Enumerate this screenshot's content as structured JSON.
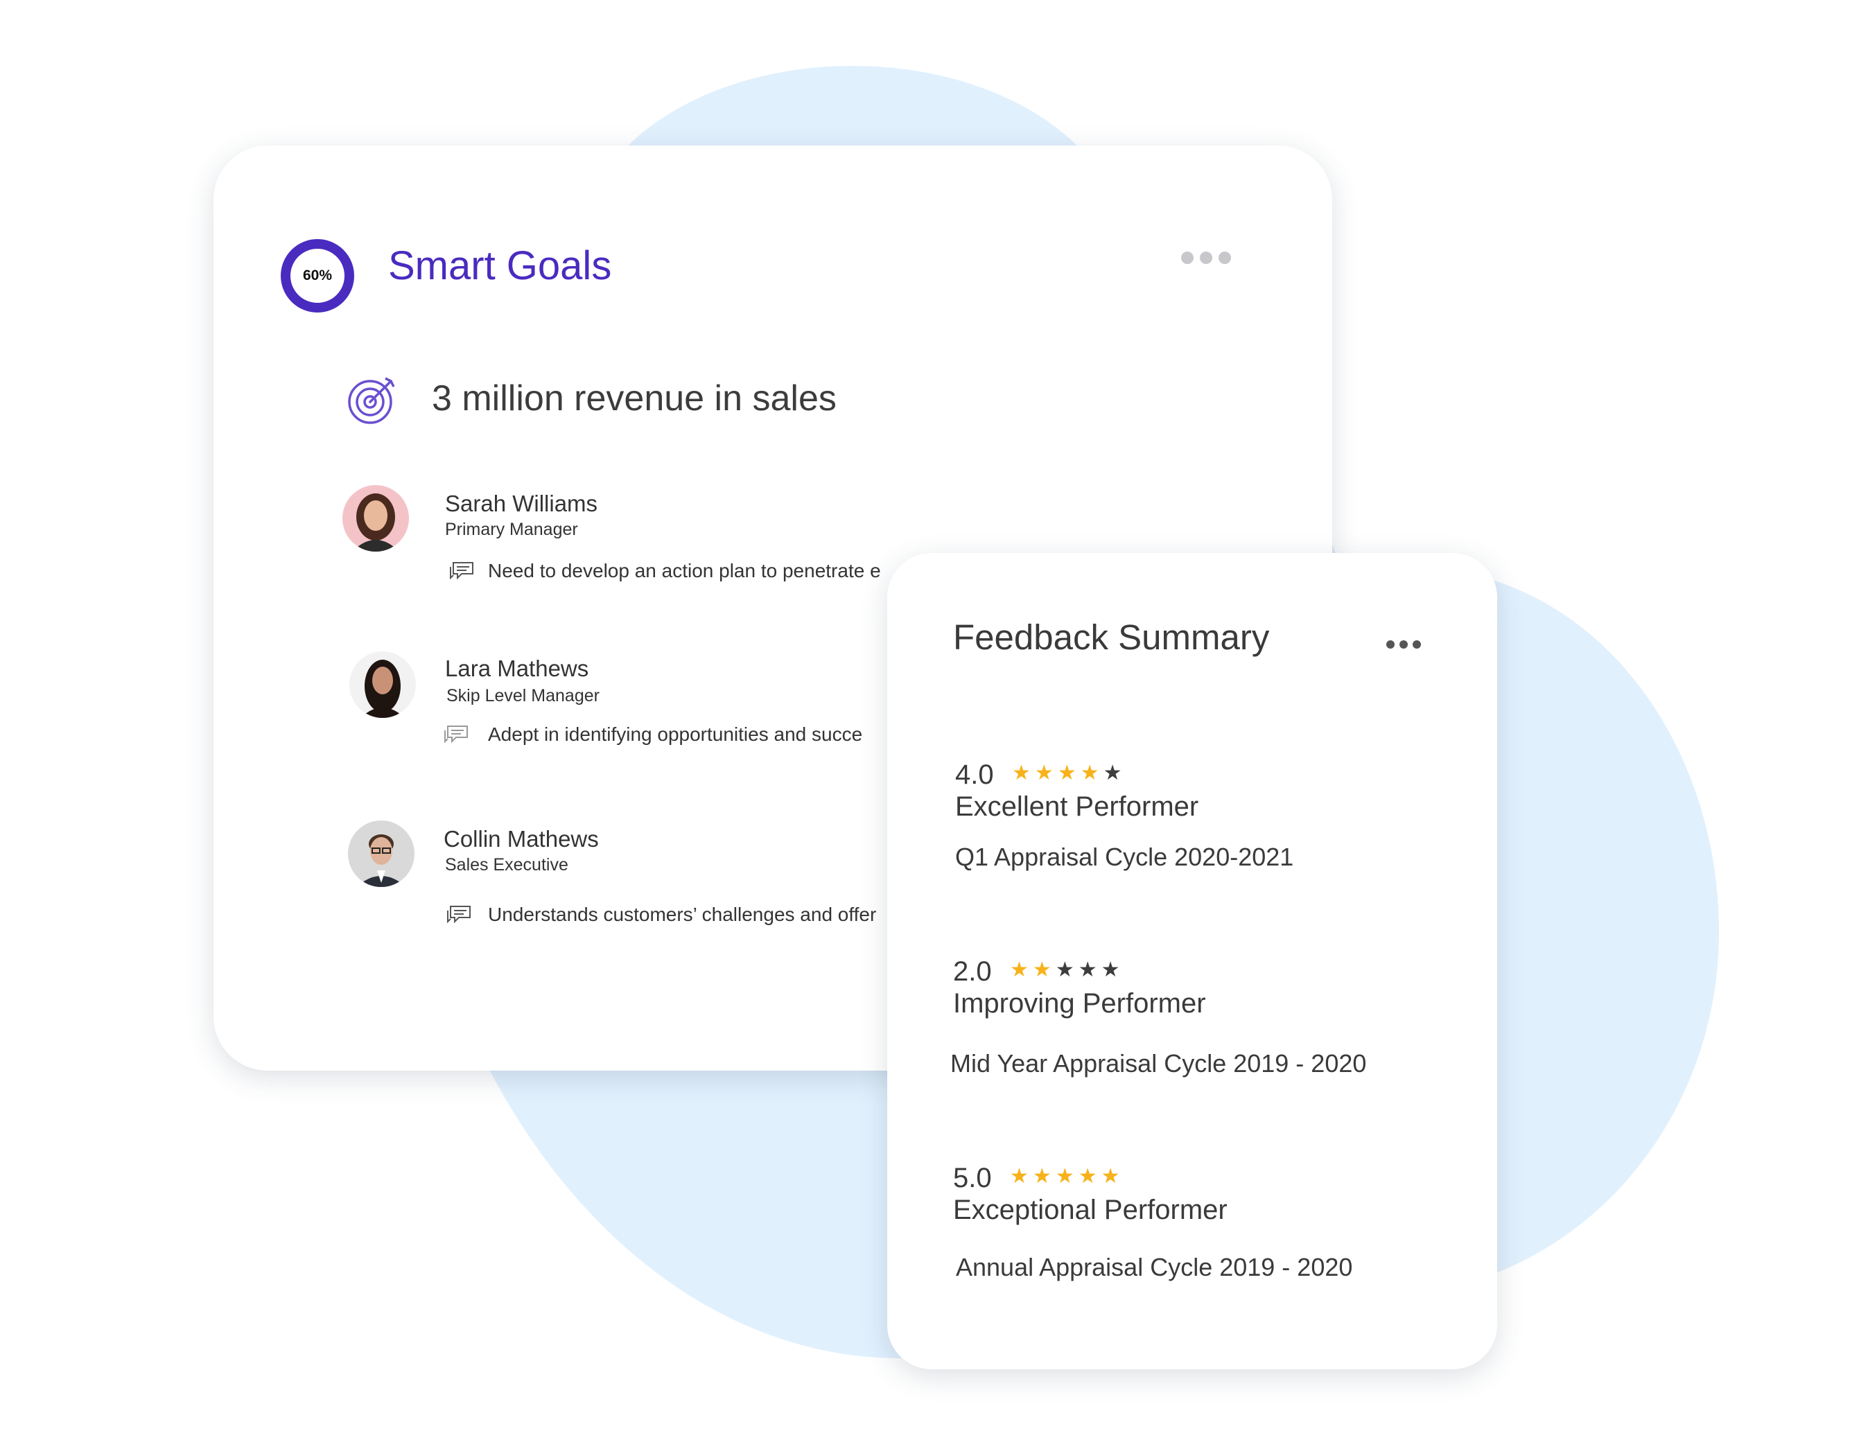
{
  "goals_card": {
    "progress_label": "60%",
    "progress_percent": 60,
    "title": "Smart Goals",
    "goal_text": "3 million revenue in sales",
    "accent_color": "#4a2bbf",
    "people": [
      {
        "name": "Sarah Williams",
        "role": "Primary Manager",
        "comment": "Need to develop an action plan to penetrate e"
      },
      {
        "name": "Lara Mathews",
        "role": "Skip Level Manager",
        "comment": "Adept in identifying opportunities and succe"
      },
      {
        "name": "Collin Mathews",
        "role": "Sales Executive",
        "comment": "Understands customers’ challenges and offer"
      }
    ]
  },
  "feedback_card": {
    "title": "Feedback Summary",
    "star_color": "#f7b21a",
    "ratings": [
      {
        "value": "4.0",
        "stars_filled": 4,
        "label": "Excellent Performer",
        "cycle": "Q1 Appraisal Cycle 2020-2021"
      },
      {
        "value": "2.0",
        "stars_filled": 2,
        "label": "Improving Performer",
        "cycle": "Mid Year Appraisal Cycle 2019 - 2020"
      },
      {
        "value": "5.0",
        "stars_filled": 5,
        "label": "Exceptional Performer",
        "cycle": "Annual Appraisal Cycle 2019 - 2020"
      }
    ]
  },
  "icons": {
    "goal": "target-icon",
    "comment": "comment-icon",
    "more": "more-options-icon",
    "star": "star-icon"
  }
}
